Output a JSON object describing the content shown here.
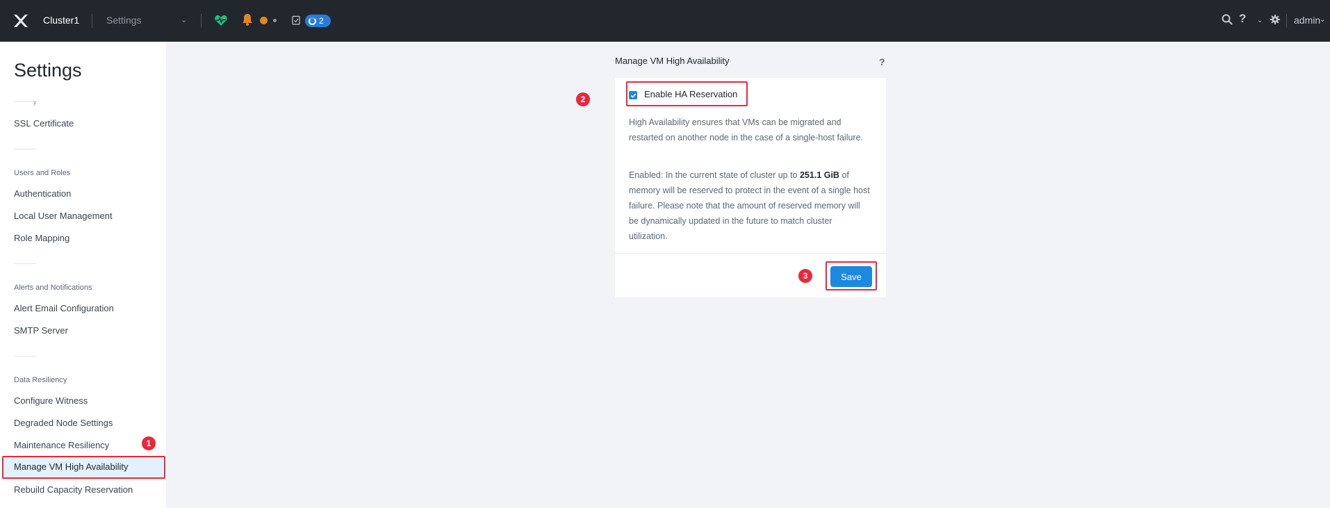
{
  "topbar": {
    "cluster_name": "Cluster1",
    "nav_select_value": "Settings",
    "task_count": "2",
    "user_label": "admin",
    "colors": {
      "bar_bg": "#22272e",
      "health": "#1fbf7a",
      "alert": "#e3861c",
      "task_badge": "#2a7bd6"
    }
  },
  "sidebar": {
    "title": "Settings",
    "truncated_item": "y",
    "items_top": [
      {
        "label": "SSL Certificate"
      }
    ],
    "groups": [
      {
        "label": "Users and Roles",
        "items": [
          {
            "label": "Authentication"
          },
          {
            "label": "Local User Management"
          },
          {
            "label": "Role Mapping"
          }
        ]
      },
      {
        "label": "Alerts and Notifications",
        "items": [
          {
            "label": "Alert Email Configuration"
          },
          {
            "label": "SMTP Server"
          }
        ]
      },
      {
        "label": "Data Resiliency",
        "items": [
          {
            "label": "Configure Witness"
          },
          {
            "label": "Degraded Node Settings"
          },
          {
            "label": "Maintenance Resiliency"
          },
          {
            "label": "Manage VM High Availability",
            "active": true
          },
          {
            "label": "Rebuild Capacity Reservation"
          }
        ]
      }
    ]
  },
  "panel": {
    "title": "Manage VM High Availability",
    "help": "?",
    "checkbox_label": "Enable HA Reservation",
    "checkbox_checked": true,
    "description": "High Availability ensures that VMs can be migrated and restarted on another node in the case of a single-host failure.",
    "enabled_prefix": "Enabled: In the current state of cluster up to ",
    "enabled_amount": "251.1 GiB",
    "enabled_suffix": " of memory will be reserved to protect in the event of a single host failure. Please note that the amount of reserved memory will be dynamically updated in the future to match cluster utilization.",
    "save_label": "Save",
    "accent": "#1b88e2"
  },
  "annotations": {
    "highlight_color": "#e8283c",
    "steps": [
      "1",
      "2",
      "3"
    ]
  }
}
